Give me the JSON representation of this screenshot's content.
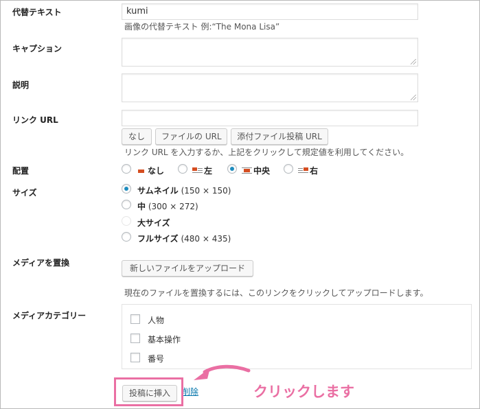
{
  "fields": {
    "alt_text": {
      "label": "代替テキスト",
      "value": "kumi",
      "hint": "画像の代替テキスト 例:“The Mona Lisa”"
    },
    "caption": {
      "label": "キャプション",
      "value": ""
    },
    "description": {
      "label": "説明",
      "value": ""
    },
    "link_url": {
      "label": "リンク URL",
      "value": "",
      "buttons": [
        "なし",
        "ファイルの URL",
        "添付ファイル投稿 URL"
      ],
      "hint": "リンク URL を入力するか、上記をクリックして規定値を利用してください。"
    },
    "alignment": {
      "label": "配置",
      "options": [
        "なし",
        "左",
        "中央",
        "右"
      ],
      "selected": "中央"
    },
    "size": {
      "label": "サイズ",
      "options": [
        {
          "name": "サムネイル",
          "dims": "(150 × 150)",
          "selected": true,
          "enabled": true
        },
        {
          "name": "中",
          "dims": "(300 × 272)",
          "selected": false,
          "enabled": true
        },
        {
          "name": "大サイズ",
          "dims": "",
          "selected": false,
          "enabled": false
        },
        {
          "name": "フルサイズ",
          "dims": "(480 × 435)",
          "selected": false,
          "enabled": true
        }
      ]
    },
    "replace_media": {
      "label": "メディアを置換",
      "button": "新しいファイルをアップロード",
      "hint": "現在のファイルを置換するには、このリンクをクリックしてアップロードします。"
    },
    "media_category": {
      "label": "メディアカテゴリー",
      "items": [
        {
          "name": "人物",
          "checked": false
        },
        {
          "name": "基本操作",
          "checked": false
        },
        {
          "name": "番号",
          "checked": false
        }
      ]
    }
  },
  "actions": {
    "insert_button": "投稿に挿入",
    "delete_link": "削除"
  },
  "annotation": {
    "text": "クリックします",
    "color": "#ea6fa3"
  },
  "colors": {
    "radio_accent": "#1e8cbe",
    "link": "#0073aa",
    "align_icon": "#d54e21"
  }
}
